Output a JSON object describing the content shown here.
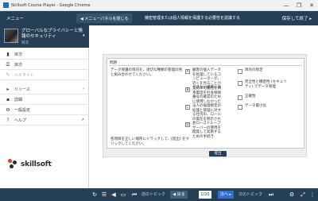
{
  "window": {
    "title": "Skillsoft Course Player - Google Chrome",
    "controls": [
      "—",
      "❐",
      "✕"
    ]
  },
  "topbar": {
    "menu_label": "メニュー",
    "close_panel_label": "◀ メニューパネルを閉じる",
    "breadcrumb": "機密管理または個人情報を保護する必要性を認識する",
    "save_exit_label": "保存して終了 ▸"
  },
  "course": {
    "title": "グローバルなプライバシーと情報のセキュリティ",
    "subtitle": "目次",
    "caret": "▾"
  },
  "sidebar": {
    "items": [
      {
        "label": "目次",
        "icon": "bookmark-icon",
        "glyph": "▮"
      },
      {
        "label": "目次",
        "icon": "list-icon",
        "glyph": "☰"
      },
      {
        "label": "ハイライト",
        "icon": "pencil-icon",
        "glyph": "✎"
      },
      {
        "label": "リソース",
        "icon": "folder-icon",
        "glyph": "▸"
      },
      {
        "label": "詳細",
        "icon": "details-icon",
        "glyph": "▪"
      },
      {
        "label": "一般設定",
        "icon": "gear-icon",
        "glyph": "⚙"
      },
      {
        "label": "ヘルプ",
        "icon": "help-icon",
        "glyph": "?"
      }
    ],
    "help_ext_glyph": "↗",
    "resources_caret": "›"
  },
  "logo": {
    "text": "skillsoft"
  },
  "question": {
    "title": "問題",
    "text": "データ保護の目的を、適切な種類の管理の例と組み合わせてください。",
    "hint": "各項目を正しい場所にドラッグして、[提出] をクリックしてください。",
    "choices": [
      {
        "letter": "A",
        "text": "顧客の個人データを処理しているコンピューターが、近くを見ることができない場所にある"
      },
      {
        "letter": "B",
        "text": "契約の可能性を問う電話を社会保障番号の確認のために使用しなかった"
      },
      {
        "letter": "C",
        "text": "法人の倫理規定の処理と管理に対する社内の、ロールの責任を明示された"
      },
      {
        "letter": "D",
        "text": "クローズドループサーバーの使用を開発して実施するための手続き"
      }
    ],
    "targets": [
      "目的の限定",
      "完全性と機密性 (セキュリティ) でデータ管理",
      "正確性",
      "データ最小化"
    ],
    "submit_label": "提出"
  },
  "bottombar": {
    "prev_label": "前のトピック",
    "back_label": "◀ 戻る",
    "page_label": "1/20",
    "next_label": "次へ ▸",
    "next_topic_label": "次のトピック"
  }
}
